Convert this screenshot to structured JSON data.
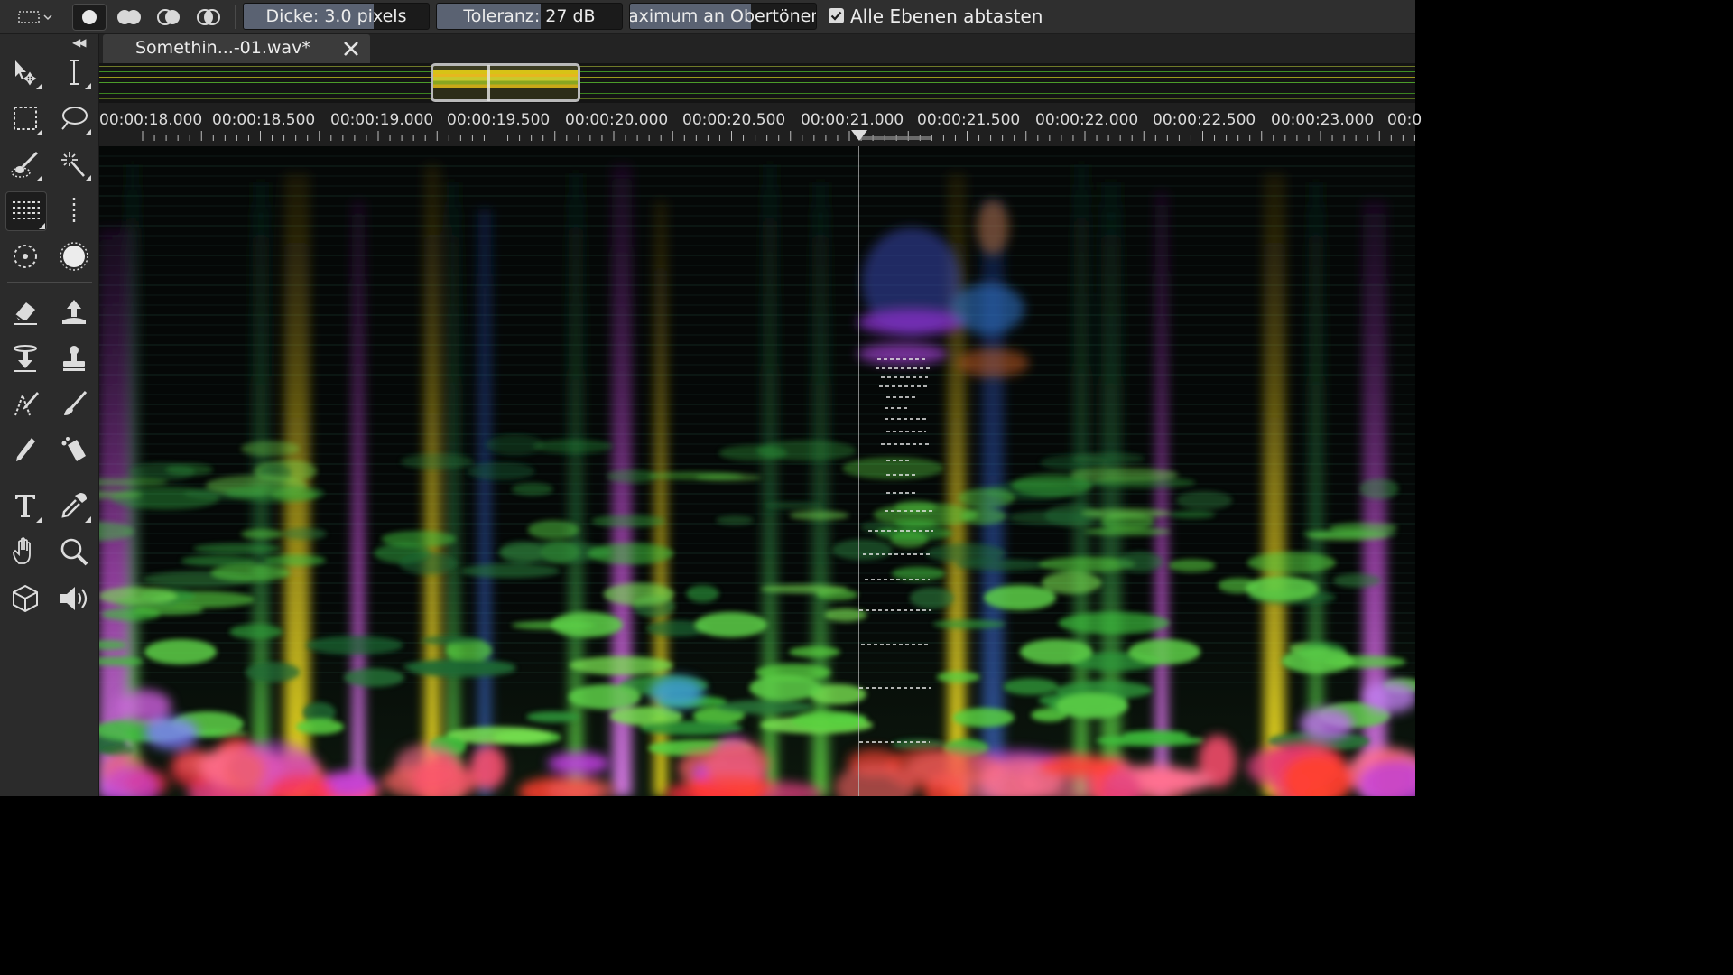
{
  "options_bar": {
    "selection_mode_icon": "marquee-dropdown-icon",
    "shape_buttons": [
      "brush-round-icon",
      "brush-double-icon",
      "brush-half-icon",
      "brush-overlap-icon"
    ],
    "thickness_label": "Dicke: 3.0 pixels",
    "thickness_fill": 0.7,
    "tolerance_label": "Toleranz: 27 dB",
    "tolerance_fill": 0.56,
    "harmonics_label": "aximum an Obertönen:",
    "harmonics_fill": 0.65,
    "sample_all_layers_label": "Alle Ebenen abtasten",
    "sample_all_layers_checked": true
  },
  "toolbar": {
    "collapse_icon": "collapse-left-icon",
    "tools": [
      [
        "move-tool-icon",
        "time-selection-icon"
      ],
      [
        "marquee-tool-icon",
        "lasso-tool-icon"
      ],
      [
        "brush-selection-icon",
        "magic-wand-icon"
      ],
      [
        "frequency-selection-icon",
        "spot-selection-icon"
      ],
      [
        "spot-healing-icon",
        "auto-heal-icon"
      ],
      [
        "eraser-icon",
        "pitch-up-icon"
      ],
      [
        "pitch-down-icon",
        "clone-stamp-icon"
      ],
      [
        "pitch-pencil-icon",
        "paint-brush-icon"
      ],
      [
        "pencil-icon",
        "bucket-icon"
      ],
      [
        "text-tool-icon",
        "eyedropper-icon"
      ],
      [
        "hand-tool-icon",
        "zoom-tool-icon"
      ],
      [
        "3d-view-icon",
        "speaker-icon"
      ]
    ]
  },
  "tab": {
    "title": "Somethin...-01.wav*",
    "close_icon": "close-icon"
  },
  "ruler": {
    "labels": [
      "00:00:18.000",
      "00:00:18.500",
      "00:00:19.000",
      "00:00:19.500",
      "00:00:20.000",
      "00:00:20.500",
      "00:00:21.000",
      "00:00:21.500",
      "00:00:22.000",
      "00:00:22.500",
      "00:00:23.000",
      "00:0"
    ]
  },
  "colors": {
    "toolbar_bg": "#2b2b2b",
    "options_bg": "#2f2f2f",
    "slider_fill": "#5a6272",
    "accent_yellow": "#e6c21f",
    "spectro_green": "#3fcf3a",
    "spectro_red": "#ff3040",
    "spectro_magenta": "#c040e0"
  }
}
